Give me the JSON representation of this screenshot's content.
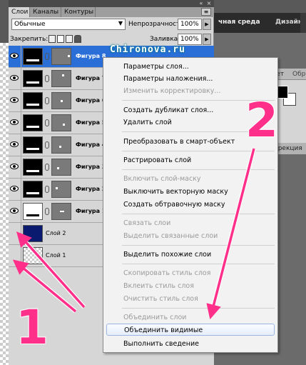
{
  "workspace": {
    "essentials": "чная среда",
    "design": "Дизайн"
  },
  "right_panel": {
    "tab1": "вет",
    "tab2": "Обр",
    "adjustments": "ррекция"
  },
  "layers_panel": {
    "tabs": [
      "Слои",
      "Каналы",
      "Контуры"
    ],
    "menu_glyph": "≡",
    "minimize_glyph": "«",
    "close_glyph": "×",
    "blend_mode": "Обычные",
    "blend_arrow": "▼",
    "opacity_label": "Непрозрачность:",
    "opacity_value": "100%",
    "lock_label": "Закрепить:",
    "fill_label": "Заливка:",
    "fill_value": "100%",
    "step_arrow": "▶",
    "layers": [
      {
        "name": "Фигура 8",
        "selected": true
      },
      {
        "name": "Фигура 7"
      },
      {
        "name": "Фигура 6"
      },
      {
        "name": "Фигура 5"
      },
      {
        "name": "Фигура 4"
      },
      {
        "name": "Фигура 3"
      },
      {
        "name": "Фигура 2"
      },
      {
        "name": "Фигура 1"
      },
      {
        "name": "Слой 2"
      },
      {
        "name": "Слой 1"
      }
    ]
  },
  "watermark": "Chironova.ru",
  "context_menu": {
    "items": [
      {
        "label": "Параметры слоя...",
        "disabled": false
      },
      {
        "label": "Параметры наложения...",
        "disabled": false
      },
      {
        "label": "Изменить корректировку...",
        "disabled": true
      },
      {
        "label": "Создать дубликат слоя...",
        "disabled": false
      },
      {
        "label": "Удалить слой",
        "disabled": false
      },
      {
        "label": "Преобразовать в смарт-объект",
        "disabled": false
      },
      {
        "label": "Растрировать слой",
        "disabled": false
      },
      {
        "label": "Включить слой-маску",
        "disabled": true
      },
      {
        "label": "Выключить векторную маску",
        "disabled": false
      },
      {
        "label": "Создать обтравочную маску",
        "disabled": false
      },
      {
        "label": "Связать слои",
        "disabled": true
      },
      {
        "label": "Выделить связанные слои",
        "disabled": true
      },
      {
        "label": "Выделить похожие слои",
        "disabled": false
      },
      {
        "label": "Скопировать стиль слоя",
        "disabled": true
      },
      {
        "label": "Вклеить стиль слоя",
        "disabled": true
      },
      {
        "label": "Очистить стиль слоя",
        "disabled": true
      },
      {
        "label": "Объединить слои",
        "disabled": true
      },
      {
        "label": "Объединить видимые",
        "disabled": false,
        "highlighted": true
      },
      {
        "label": "Выполнить сведение",
        "disabled": false
      }
    ]
  },
  "annotations": {
    "one": "1",
    "two": "2",
    "color": "#ff2f8a"
  }
}
